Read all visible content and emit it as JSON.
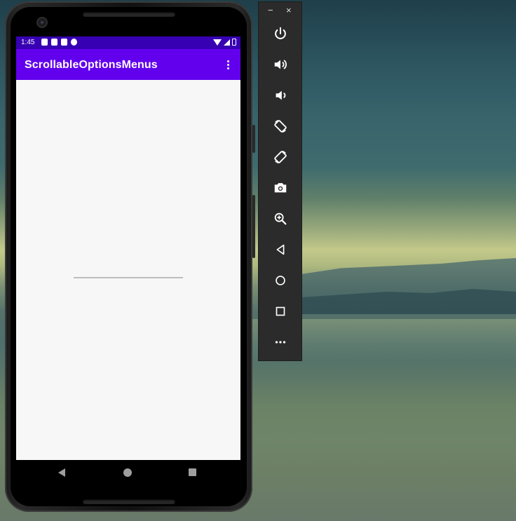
{
  "statusbar": {
    "time": "1:45"
  },
  "appbar": {
    "title": "ScrollableOptionsMenus"
  },
  "emulator_toolbar": {
    "minimize": "−",
    "close": "×",
    "buttons": [
      {
        "name": "power",
        "icon": "power-icon"
      },
      {
        "name": "volume-up",
        "icon": "volume-up-icon"
      },
      {
        "name": "volume-down",
        "icon": "volume-down-icon"
      },
      {
        "name": "rotate-left",
        "icon": "rotate-left-icon"
      },
      {
        "name": "rotate-right",
        "icon": "rotate-right-icon"
      },
      {
        "name": "screenshot",
        "icon": "camera-icon"
      },
      {
        "name": "zoom",
        "icon": "zoom-in-icon"
      },
      {
        "name": "back",
        "icon": "back-icon"
      },
      {
        "name": "home",
        "icon": "home-icon"
      },
      {
        "name": "overview",
        "icon": "overview-icon"
      },
      {
        "name": "more",
        "icon": "more-icon"
      }
    ]
  },
  "colors": {
    "statusbar": "#3700b3",
    "appbar": "#6200ee",
    "screen_background": "#f7f7f7"
  }
}
